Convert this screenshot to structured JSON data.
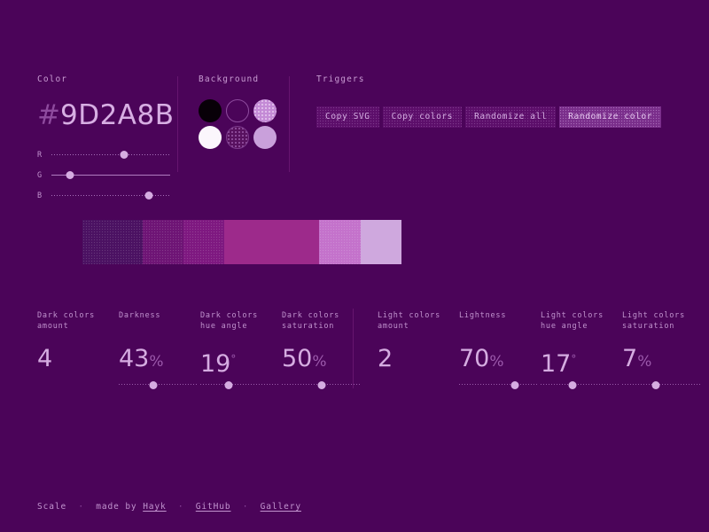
{
  "background_color": "#4B0459",
  "color_section": {
    "label": "Color",
    "hash": "#",
    "hex": "9D2A8B",
    "sliders": [
      {
        "name": "R",
        "letter": "R",
        "percent": 61,
        "style": "dotted"
      },
      {
        "name": "G",
        "letter": "G",
        "percent": 16,
        "style": "solid"
      },
      {
        "name": "B",
        "letter": "B",
        "percent": 82,
        "style": "dotted"
      }
    ]
  },
  "background_section": {
    "label": "Background",
    "swatches": [
      {
        "name": "black",
        "color": "#080008",
        "selected": false
      },
      {
        "name": "outline",
        "color": "transparent",
        "selected": false
      },
      {
        "name": "light-lilac-dotted",
        "color": "#C48BD6",
        "selected": false
      },
      {
        "name": "white",
        "color": "#FBF6FC",
        "selected": false
      },
      {
        "name": "dark-purple-dotted",
        "color": "#58115F",
        "selected": true
      },
      {
        "name": "lilac",
        "color": "#C9A0DB",
        "selected": false
      }
    ]
  },
  "triggers_section": {
    "label": "Triggers",
    "buttons": [
      {
        "label": "Copy SVG",
        "active": false
      },
      {
        "label": "Copy colors",
        "active": false
      },
      {
        "label": "Randomize all",
        "active": false
      },
      {
        "label": "Randomize color",
        "active": true
      }
    ]
  },
  "palette": {
    "swatches": [
      {
        "name": "shade-1",
        "color": "#4B1162",
        "width": 68
      },
      {
        "name": "shade-2",
        "color": "#6E1475",
        "width": 46
      },
      {
        "name": "shade-3",
        "color": "#7E1880",
        "width": 46
      },
      {
        "name": "shade-4",
        "color": "#9D2A8B",
        "width": 107
      },
      {
        "name": "tint-1",
        "color": "#C472CB",
        "width": 47
      },
      {
        "name": "tint-2",
        "color": "#CFA8DE",
        "width": 46
      }
    ]
  },
  "params": {
    "dark": [
      {
        "name": "dark-colors-amount",
        "label": "Dark colors\namount",
        "value": "4",
        "unit": "",
        "has_slider": false,
        "slider_percent": 0
      },
      {
        "name": "darkness",
        "label": "Darkness",
        "value": "43",
        "unit": "%",
        "has_slider": true,
        "slider_percent": 43
      },
      {
        "name": "dark-colors-hue-angle",
        "label": "Dark colors\nhue angle",
        "value": "19",
        "unit": "°",
        "has_slider": true,
        "slider_percent": 36
      },
      {
        "name": "dark-colors-saturation",
        "label": "Dark colors\nsaturation",
        "value": "50",
        "unit": "%",
        "has_slider": true,
        "slider_percent": 50
      }
    ],
    "light": [
      {
        "name": "light-colors-amount",
        "label": "Light colors\namount",
        "value": "2",
        "unit": "",
        "has_slider": false,
        "slider_percent": 0
      },
      {
        "name": "lightness",
        "label": "Lightness",
        "value": "70",
        "unit": "%",
        "has_slider": true,
        "slider_percent": 70
      },
      {
        "name": "light-colors-hue-angle",
        "label": "Light colors\nhue angle",
        "value": "17",
        "unit": "°",
        "has_slider": true,
        "slider_percent": 40
      },
      {
        "name": "light-colors-saturation",
        "label": "Light colors\nsaturation",
        "value": "7",
        "unit": "%",
        "has_slider": true,
        "slider_percent": 42
      }
    ]
  },
  "footer": {
    "brand": "Scale",
    "sep1": "  ·  ",
    "made_by": "made by ",
    "author": "Hayk",
    "sep2": "  ·  ",
    "github": "GitHub",
    "sep3": "  ·  ",
    "gallery": "Gallery"
  }
}
